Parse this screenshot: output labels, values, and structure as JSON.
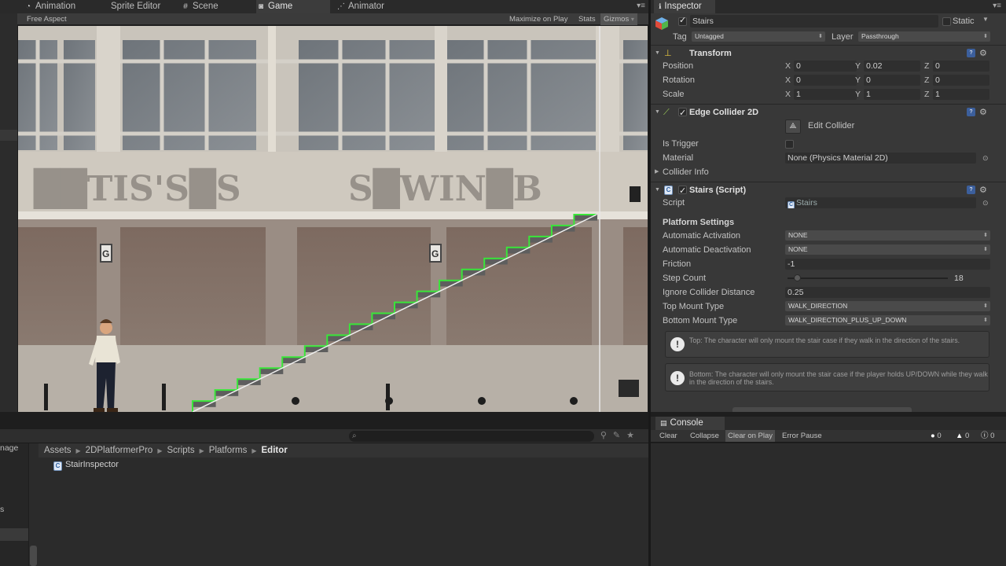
{
  "tabs": [
    {
      "label": "Animation",
      "icon": "animation-icon"
    },
    {
      "label": "Sprite Editor",
      "icon": ""
    },
    {
      "label": "Scene",
      "icon": "scene-icon"
    },
    {
      "label": "Game",
      "icon": "game-icon"
    },
    {
      "label": "Animator",
      "icon": "animator-icon"
    }
  ],
  "game_toolbar": {
    "aspect": "Free Aspect",
    "maximize": "Maximize on Play",
    "stats": "Stats",
    "gizmos": "Gizmos"
  },
  "game_view": {
    "wall_letters_left": "██TIS'S█S",
    "wall_letters_right": "S█WIN█B",
    "sign_letter": "G",
    "stair_color": "#39e639"
  },
  "project": {
    "left_fragments": [
      "nage",
      "s"
    ],
    "breadcrumb": [
      "Assets",
      "2DPlatformerPro",
      "Scripts",
      "Platforms",
      "Editor"
    ],
    "files": [
      "StairInspector"
    ]
  },
  "inspector": {
    "tab_label": "Inspector",
    "object_name": "Stairs",
    "active_checked": true,
    "static_label": "Static",
    "tag_label": "Tag",
    "tag_value": "Untagged",
    "layer_label": "Layer",
    "layer_value": "Passthrough",
    "transform": {
      "title": "Transform",
      "position": {
        "label": "Position",
        "x": "0",
        "y": "0.02",
        "z": "0"
      },
      "rotation": {
        "label": "Rotation",
        "x": "0",
        "y": "0",
        "z": "0"
      },
      "scale": {
        "label": "Scale",
        "x": "1",
        "y": "1",
        "z": "1"
      }
    },
    "edge_collider": {
      "title": "Edge Collider 2D",
      "enabled": true,
      "edit_label": "Edit Collider",
      "is_trigger_label": "Is Trigger",
      "is_trigger": false,
      "material_label": "Material",
      "material_value": "None (Physics Material 2D)",
      "collider_info_label": "Collider Info"
    },
    "stairs_script": {
      "title": "Stairs (Script)",
      "enabled": true,
      "script_label": "Script",
      "script_value": "Stairs",
      "section_title": "Platform Settings",
      "auto_activation_label": "Automatic Activation",
      "auto_activation_value": "NONE",
      "auto_deactivation_label": "Automatic Deactivation",
      "auto_deactivation_value": "NONE",
      "friction_label": "Friction",
      "friction_value": "-1",
      "step_count_label": "Step Count",
      "step_count_value": "18",
      "step_count_fraction": 0.06,
      "ignore_distance_label": "Ignore Collider Distance",
      "ignore_distance_value": "0.25",
      "top_mount_label": "Top Mount Type",
      "top_mount_value": "WALK_DIRECTION",
      "bottom_mount_label": "Bottom Mount Type",
      "bottom_mount_value": "WALK_DIRECTION_PLUS_UP_DOWN",
      "help_top": "Top: The character will only mount the stair case if they walk in the direction of the stairs.",
      "help_bottom": "Bottom: The character will only mount the stair case if the player holds UP/DOWN while they walk in the direction of the stairs."
    }
  },
  "console": {
    "tab_label": "Console",
    "buttons": [
      "Clear",
      "Collapse",
      "Clear on Play",
      "Error Pause"
    ],
    "active_button": "Clear on Play",
    "counts": {
      "errors": "0",
      "warnings": "0",
      "messages": "0"
    }
  }
}
